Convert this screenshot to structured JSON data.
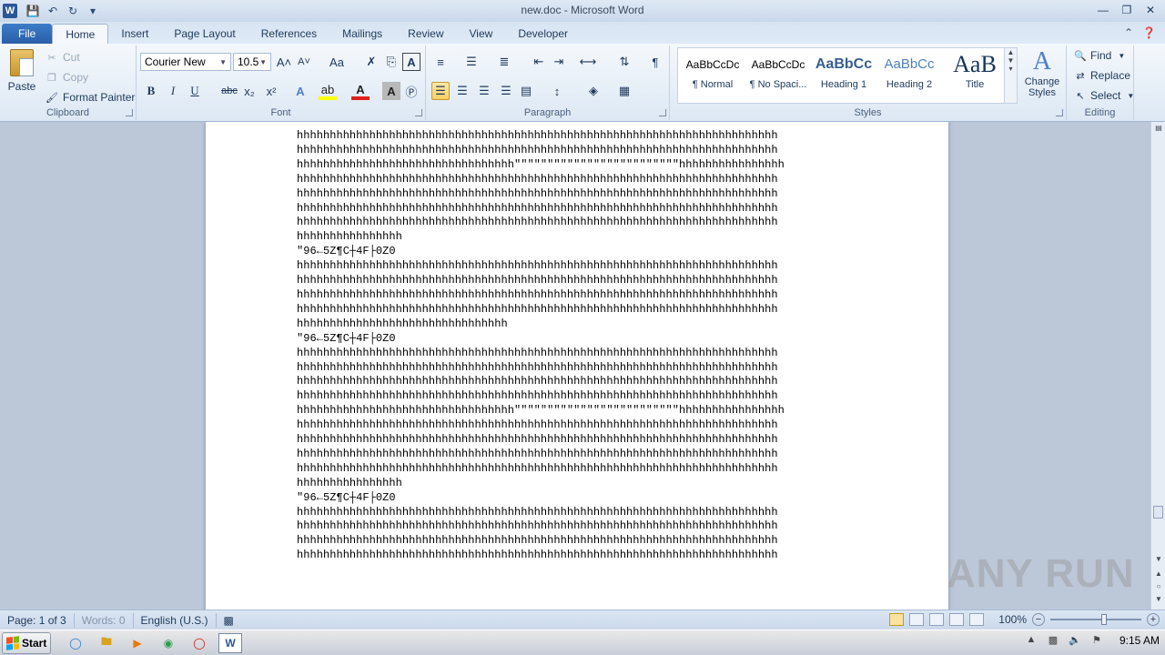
{
  "window": {
    "title": "new.doc - Microsoft Word",
    "app_icon_letter": "W",
    "controls": [
      "minimize-icon",
      "restore-icon",
      "close-icon"
    ]
  },
  "quick_access": {
    "items": [
      "save-icon",
      "undo-icon",
      "redo-icon",
      "customize-icon"
    ]
  },
  "tabs": {
    "file": "File",
    "items": [
      "Home",
      "Insert",
      "Page Layout",
      "References",
      "Mailings",
      "Review",
      "View",
      "Developer"
    ],
    "active": "Home"
  },
  "ribbon": {
    "clipboard": {
      "label": "Clipboard",
      "paste": "Paste",
      "cut": "Cut",
      "copy": "Copy",
      "format_painter": "Format Painter"
    },
    "font": {
      "label": "Font",
      "font_name": "Courier New",
      "font_size": "10.5",
      "grow_icon": "A˄",
      "shrink_icon": "A˅",
      "case": "Aa",
      "bold": "B",
      "italic": "I",
      "underline": "U",
      "strike": "abc",
      "subscript": "x₂",
      "superscript": "x²"
    },
    "paragraph": {
      "label": "Paragraph",
      "pilcrow": "¶"
    },
    "styles": {
      "label": "Styles",
      "items": [
        {
          "sample": "AaBbCcDc",
          "name": "¶ Normal"
        },
        {
          "sample": "AaBbCcDc",
          "name": "¶ No Spaci..."
        },
        {
          "sample": "AaBbCc",
          "name": "Heading 1"
        },
        {
          "sample": "AaBbCc",
          "name": "Heading 2"
        },
        {
          "sample": "AaB",
          "name": "Title"
        }
      ],
      "change_styles": "Change Styles"
    },
    "editing": {
      "label": "Editing",
      "find": "Find",
      "replace": "Replace",
      "select": "Select"
    }
  },
  "document": {
    "lines": [
      "hhhhhhhhhhhhhhhhhhhhhhhhhhhhhhhhhhhhhhhhhhhhhhhhhhhhhhhhhhhhhhhhhhhhhhhhh",
      "hhhhhhhhhhhhhhhhhhhhhhhhhhhhhhhhhhhhhhhhhhhhhhhhhhhhhhhhhhhhhhhhhhhhhhhhh",
      "hhhhhhhhhhhhhhhhhhhhhhhhhhhhhhhhh\"\"\"\"\"\"\"\"\"\"\"\"\"\"\"\"\"\"\"\"\"\"\"\"\"hhhhhhhhhhhhhhhh",
      "hhhhhhhhhhhhhhhhhhhhhhhhhhhhhhhhhhhhhhhhhhhhhhhhhhhhhhhhhhhhhhhhhhhhhhhhh",
      "hhhhhhhhhhhhhhhhhhhhhhhhhhhhhhhhhhhhhhhhhhhhhhhhhhhhhhhhhhhhhhhhhhhhhhhhh",
      "hhhhhhhhhhhhhhhhhhhhhhhhhhhhhhhhhhhhhhhhhhhhhhhhhhhhhhhhhhhhhhhhhhhhhhhhh",
      "hhhhhhhhhhhhhhhhhhhhhhhhhhhhhhhhhhhhhhhhhhhhhhhhhhhhhhhhhhhhhhhhhhhhhhhhh",
      "hhhhhhhhhhhhhhhh",
      "\"96←5Z¶C┼4F├0Z0",
      "hhhhhhhhhhhhhhhhhhhhhhhhhhhhhhhhhhhhhhhhhhhhhhhhhhhhhhhhhhhhhhhhhhhhhhhhh",
      "hhhhhhhhhhhhhhhhhhhhhhhhhhhhhhhhhhhhhhhhhhhhhhhhhhhhhhhhhhhhhhhhhhhhhhhhh",
      "hhhhhhhhhhhhhhhhhhhhhhhhhhhhhhhhhhhhhhhhhhhhhhhhhhhhhhhhhhhhhhhhhhhhhhhhh",
      "hhhhhhhhhhhhhhhhhhhhhhhhhhhhhhhhhhhhhhhhhhhhhhhhhhhhhhhhhhhhhhhhhhhhhhhhh",
      "hhhhhhhhhhhhhhhhhhhhhhhhhhhhhhhh",
      "\"96←5Z¶C┼4F├0Z0",
      "hhhhhhhhhhhhhhhhhhhhhhhhhhhhhhhhhhhhhhhhhhhhhhhhhhhhhhhhhhhhhhhhhhhhhhhhh",
      "hhhhhhhhhhhhhhhhhhhhhhhhhhhhhhhhhhhhhhhhhhhhhhhhhhhhhhhhhhhhhhhhhhhhhhhhh",
      "hhhhhhhhhhhhhhhhhhhhhhhhhhhhhhhhhhhhhhhhhhhhhhhhhhhhhhhhhhhhhhhhhhhhhhhhh",
      "hhhhhhhhhhhhhhhhhhhhhhhhhhhhhhhhhhhhhhhhhhhhhhhhhhhhhhhhhhhhhhhhhhhhhhhhh",
      "hhhhhhhhhhhhhhhhhhhhhhhhhhhhhhhhh\"\"\"\"\"\"\"\"\"\"\"\"\"\"\"\"\"\"\"\"\"\"\"\"\"hhhhhhhhhhhhhhhh",
      "hhhhhhhhhhhhhhhhhhhhhhhhhhhhhhhhhhhhhhhhhhhhhhhhhhhhhhhhhhhhhhhhhhhhhhhhh",
      "hhhhhhhhhhhhhhhhhhhhhhhhhhhhhhhhhhhhhhhhhhhhhhhhhhhhhhhhhhhhhhhhhhhhhhhhh",
      "hhhhhhhhhhhhhhhhhhhhhhhhhhhhhhhhhhhhhhhhhhhhhhhhhhhhhhhhhhhhhhhhhhhhhhhhh",
      "hhhhhhhhhhhhhhhhhhhhhhhhhhhhhhhhhhhhhhhhhhhhhhhhhhhhhhhhhhhhhhhhhhhhhhhhh",
      "hhhhhhhhhhhhhhhh",
      "\"96←5Z¶C┼4F├0Z0",
      "hhhhhhhhhhhhhhhhhhhhhhhhhhhhhhhhhhhhhhhhhhhhhhhhhhhhhhhhhhhhhhhhhhhhhhhhh",
      "hhhhhhhhhhhhhhhhhhhhhhhhhhhhhhhhhhhhhhhhhhhhhhhhhhhhhhhhhhhhhhhhhhhhhhhhh",
      "hhhhhhhhhhhhhhhhhhhhhhhhhhhhhhhhhhhhhhhhhhhhhhhhhhhhhhhhhhhhhhhhhhhhhhhhh",
      "hhhhhhhhhhhhhhhhhhhhhhhhhhhhhhhhhhhhhhhhhhhhhhhhhhhhhhhhhhhhhhhhhhhhhhhhh"
    ]
  },
  "watermark": "ANY RUN",
  "statusbar": {
    "page": "Page: 1 of 3",
    "words": "Words: 0",
    "language": "English (U.S.)",
    "zoom": "100%",
    "zoom_level": 1.0
  },
  "taskbar": {
    "start": "Start",
    "time": "9:15 AM",
    "apps": [
      "ie-icon",
      "explorer-icon",
      "media-player-icon",
      "chrome-icon",
      "opera-icon",
      "word-icon"
    ]
  },
  "colors": {
    "accent": "#2b5797",
    "ribbon_bg": "#dde8f4",
    "doc_bg": "#bcc7d8"
  }
}
